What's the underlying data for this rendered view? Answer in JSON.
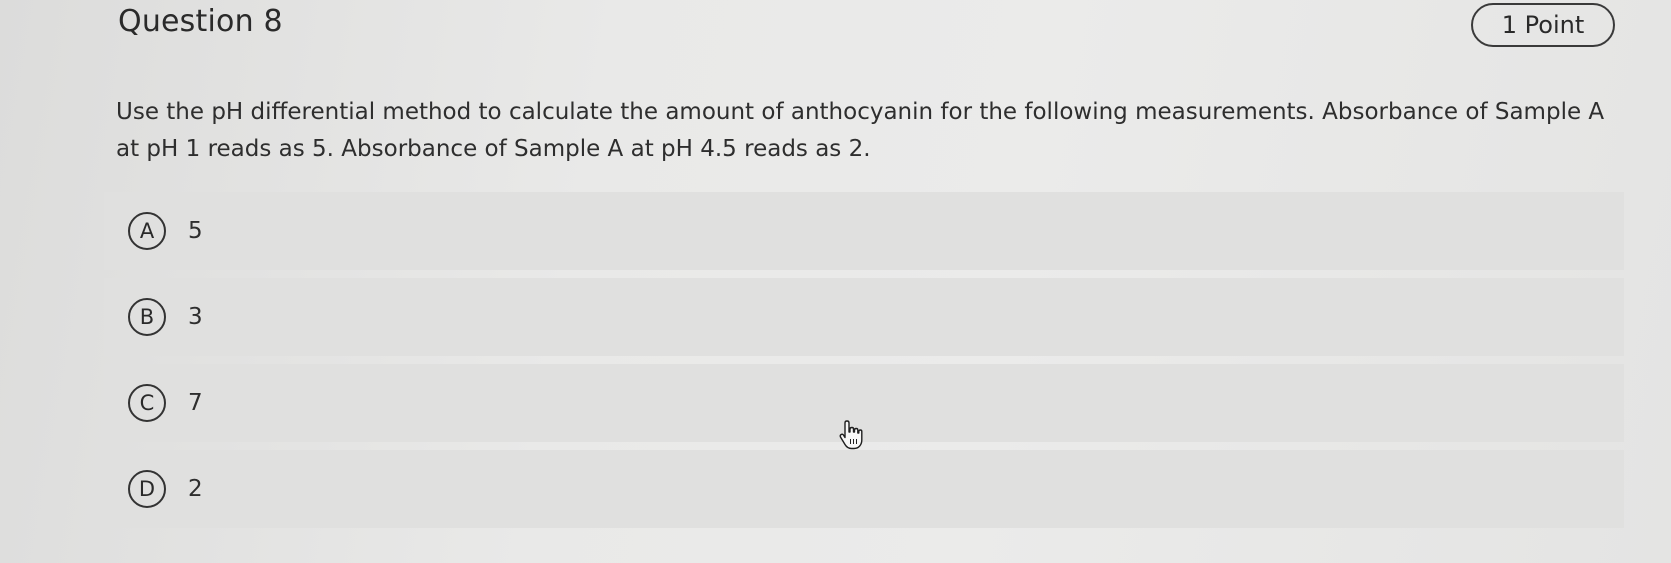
{
  "question": {
    "title": "Question 8",
    "points": "1 Point",
    "prompt": "Use the pH differential method to calculate the amount of anthocyanin for the following measurements. Absorbance of Sample A at pH 1 reads as 5. Absorbance of Sample A at pH 4.5 reads as 2."
  },
  "options": [
    {
      "letter": "A",
      "text": "5"
    },
    {
      "letter": "B",
      "text": "3"
    },
    {
      "letter": "C",
      "text": "7"
    },
    {
      "letter": "D",
      "text": "2"
    }
  ],
  "cursor_icon": "hand-pointer-icon"
}
